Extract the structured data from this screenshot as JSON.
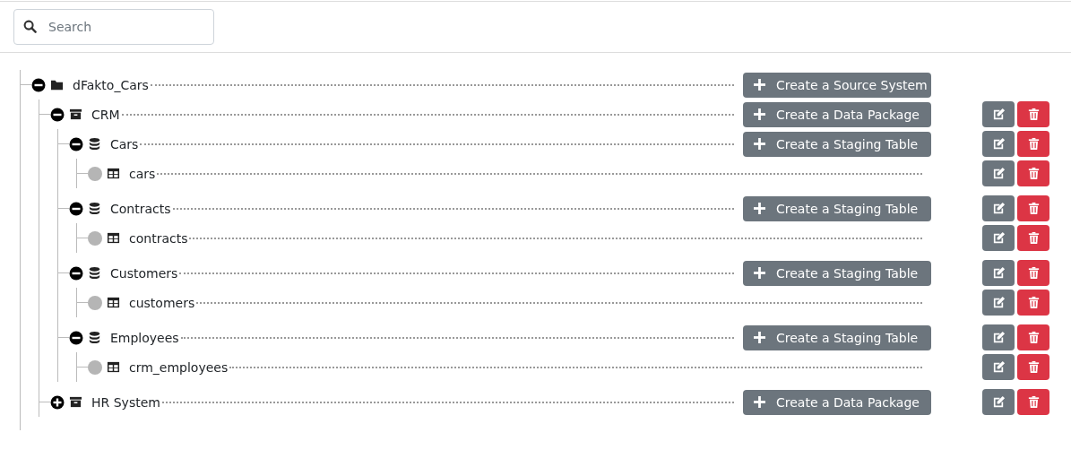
{
  "search": {
    "placeholder": "Search"
  },
  "tree": [
    {
      "kind": "folder",
      "label": "dFakto_Cars",
      "expanded": true,
      "create_button": "Create a Source System",
      "actions": false,
      "children": [
        {
          "kind": "archive",
          "label": "CRM",
          "expanded": true,
          "create_button": "Create a Data Package",
          "actions": true,
          "children": [
            {
              "kind": "database",
              "label": "Cars",
              "expanded": true,
              "create_button": "Create a Staging Table",
              "actions": true,
              "children": [
                {
                  "kind": "table",
                  "label": "cars",
                  "actions": true
                }
              ]
            },
            {
              "kind": "database",
              "label": "Contracts",
              "expanded": true,
              "create_button": "Create a Staging Table",
              "actions": true,
              "children": [
                {
                  "kind": "table",
                  "label": "contracts",
                  "actions": true
                }
              ]
            },
            {
              "kind": "database",
              "label": "Customers",
              "expanded": true,
              "create_button": "Create a Staging Table",
              "actions": true,
              "children": [
                {
                  "kind": "table",
                  "label": "customers",
                  "actions": true
                }
              ]
            },
            {
              "kind": "database",
              "label": "Employees",
              "expanded": true,
              "create_button": "Create a Staging Table",
              "actions": true,
              "children": [
                {
                  "kind": "table",
                  "label": "crm_employees",
                  "actions": true
                }
              ]
            }
          ]
        },
        {
          "kind": "archive",
          "label": "HR System",
          "expanded": false,
          "create_button": "Create a Data Package",
          "actions": true
        }
      ]
    }
  ]
}
